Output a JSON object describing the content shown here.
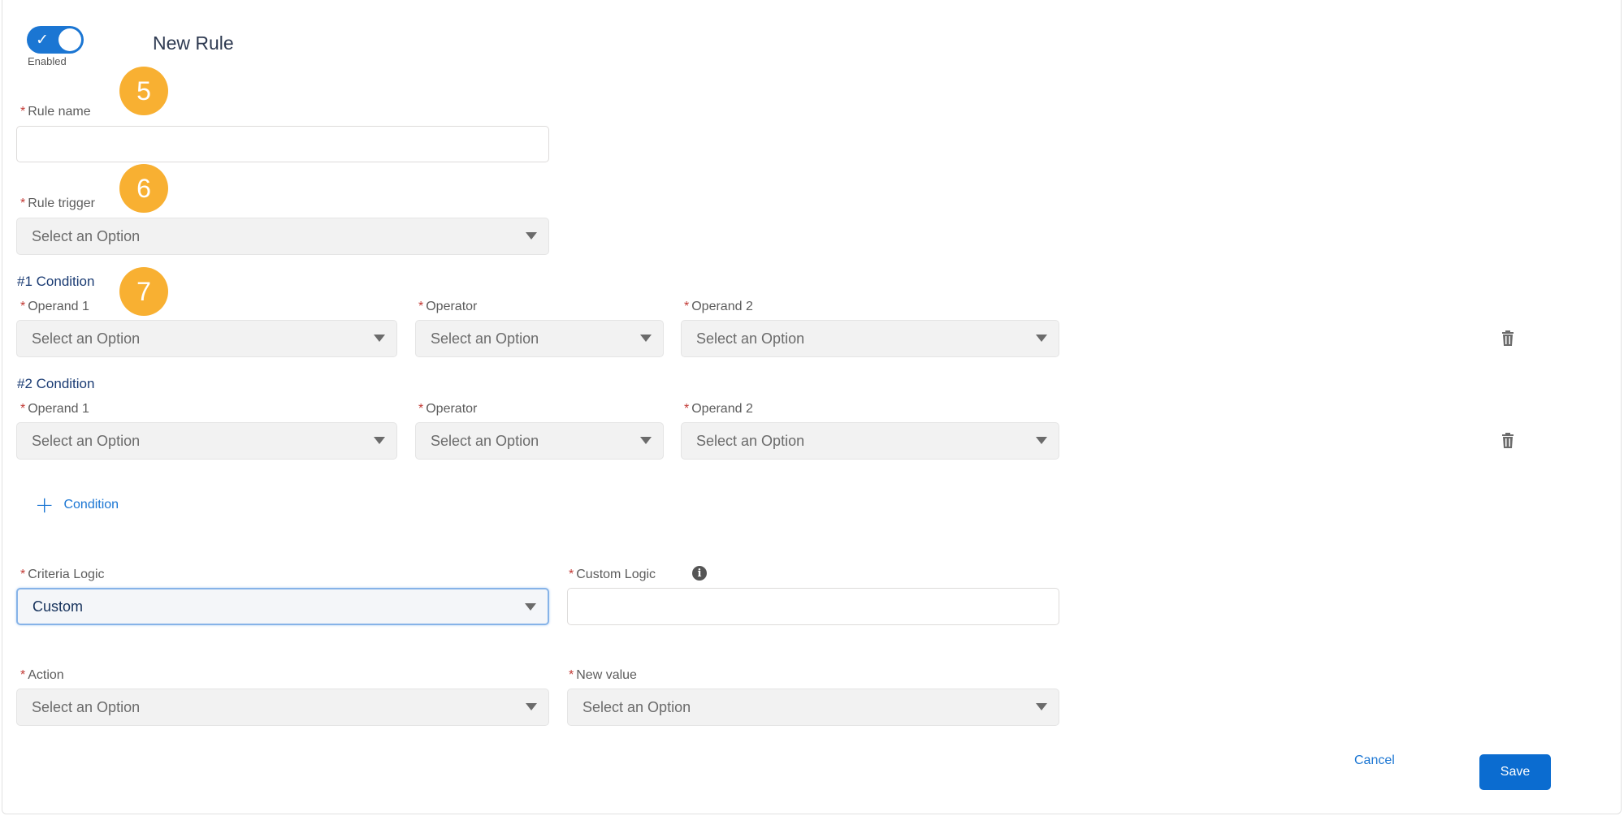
{
  "header": {
    "toggle_label": "Enabled",
    "title": "New Rule"
  },
  "badges": [
    "5",
    "6",
    "7"
  ],
  "rule_name": {
    "label": "Rule name",
    "value": ""
  },
  "rule_trigger": {
    "label": "Rule trigger",
    "value": "Select an Option"
  },
  "conditions": [
    {
      "title": "#1 Condition",
      "operand1_label": "Operand 1",
      "operand1_value": "Select an Option",
      "operator_label": "Operator",
      "operator_value": "Select an Option",
      "operand2_label": "Operand 2",
      "operand2_value": "Select an Option"
    },
    {
      "title": "#2 Condition",
      "operand1_label": "Operand 1",
      "operand1_value": "Select an Option",
      "operator_label": "Operator",
      "operator_value": "Select an Option",
      "operand2_label": "Operand 2",
      "operand2_value": "Select an Option"
    }
  ],
  "add_condition_label": "Condition",
  "criteria_logic": {
    "label": "Criteria Logic",
    "value": "Custom"
  },
  "custom_logic": {
    "label": "Custom Logic",
    "value": ""
  },
  "action": {
    "label": "Action",
    "value": "Select an Option"
  },
  "new_value": {
    "label": "New value",
    "value": "Select an Option"
  },
  "footer": {
    "cancel_label": "Cancel",
    "save_label": "Save"
  },
  "colors": {
    "accent": "#1b76d3",
    "badge": "#f8b032",
    "required": "#c23934"
  },
  "icons": {
    "toggle": "checkmark-icon",
    "add": "plus-icon",
    "delete": "trash-icon",
    "info": "info-icon"
  }
}
